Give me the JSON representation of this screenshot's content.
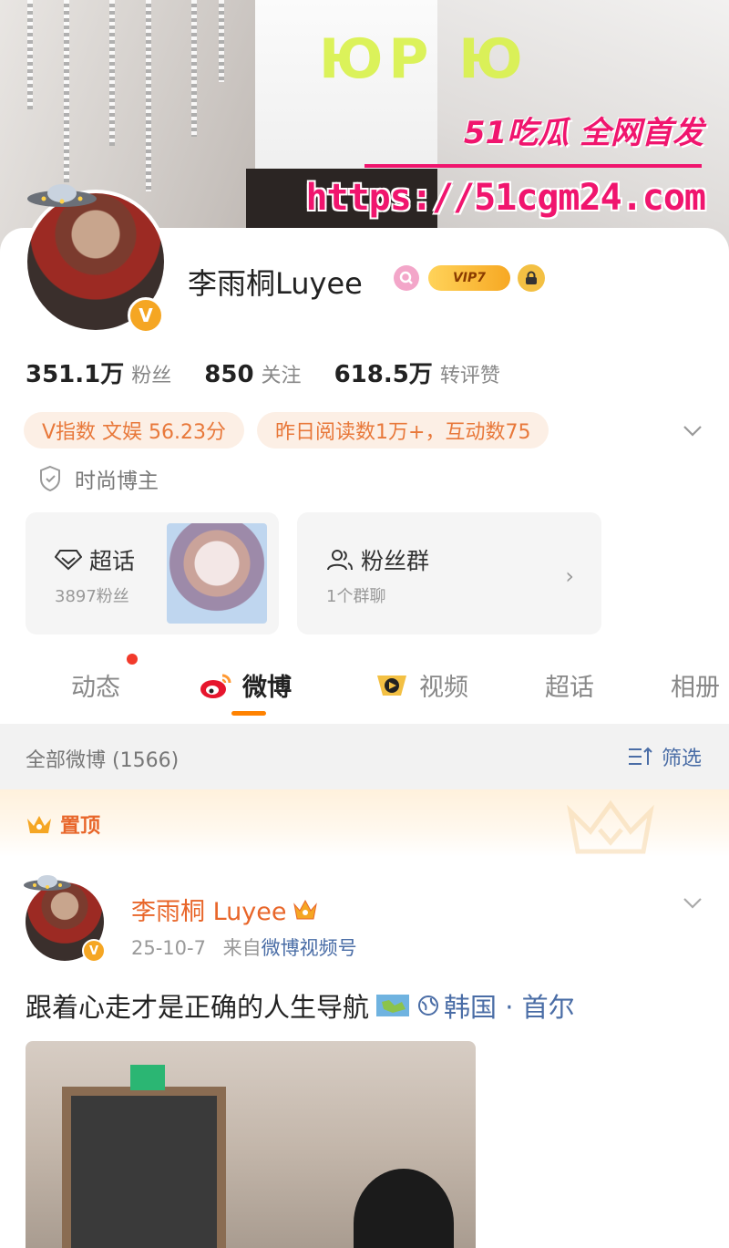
{
  "cover": {
    "watermark_top": "51吃瓜 全网首发",
    "watermark_url": "https://51cgm24.com",
    "neon_text": "ЮP Ю"
  },
  "profile": {
    "name": "李雨桐Luyee",
    "vip_label": "VIP7",
    "verified_mark": "V",
    "stats": [
      {
        "num": "351.1万",
        "label": "粉丝"
      },
      {
        "num": "850",
        "label": "关注"
      },
      {
        "num": "618.5万",
        "label": "转评赞"
      }
    ],
    "pills": [
      "V指数 文娱 56.23分",
      "昨日阅读数1万+，互动数75"
    ],
    "tagline": "时尚博主"
  },
  "tiles": {
    "chaohua": {
      "title": "超话",
      "sub": "3897粉丝"
    },
    "fans_group": {
      "title": "粉丝群",
      "sub": "1个群聊"
    }
  },
  "tabs": [
    {
      "label": "动态"
    },
    {
      "label": "微博"
    },
    {
      "label": "视频"
    },
    {
      "label": "超话"
    },
    {
      "label": "相册"
    }
  ],
  "filterbar": {
    "count": "全部微博 (1566)",
    "filter": "筛选"
  },
  "pinned": {
    "label": "置顶"
  },
  "post": {
    "author": "李雨桐 Luyee",
    "date": "25-10-7",
    "from_prefix": "来自",
    "source": "微博视频号",
    "text": "跟着心走才是正确的人生导航",
    "location": "韩国 · 首尔"
  },
  "colors": {
    "accent": "#ff8200",
    "link": "#4a6da6",
    "orange_text": "#e8662a",
    "pill_bg": "#fcefe5"
  }
}
